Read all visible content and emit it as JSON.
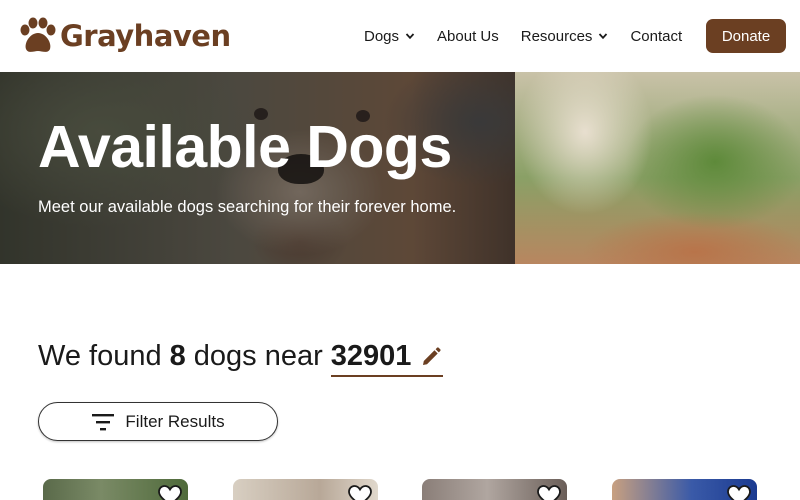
{
  "brand": {
    "name": "Grayhaven",
    "color": "#6b3f22",
    "logo_icon": "paw-icon"
  },
  "nav": {
    "items": [
      {
        "label": "Dogs",
        "has_dropdown": true
      },
      {
        "label": "About Us",
        "has_dropdown": false
      },
      {
        "label": "Resources",
        "has_dropdown": true
      },
      {
        "label": "Contact",
        "has_dropdown": false
      }
    ],
    "donate_label": "Donate"
  },
  "hero": {
    "title": "Available Dogs",
    "subtitle": "Meet our available dogs searching for their forever home."
  },
  "results": {
    "prefix": "We found",
    "count": "8",
    "middle": "dogs near",
    "zip": "32901",
    "edit_icon": "pencil-icon"
  },
  "filter": {
    "label": "Filter Results",
    "icon": "filter-icon"
  },
  "cards": [
    {
      "favorite_icon": "heart-icon"
    },
    {
      "favorite_icon": "heart-icon"
    },
    {
      "favorite_icon": "heart-icon"
    },
    {
      "favorite_icon": "heart-icon"
    }
  ]
}
